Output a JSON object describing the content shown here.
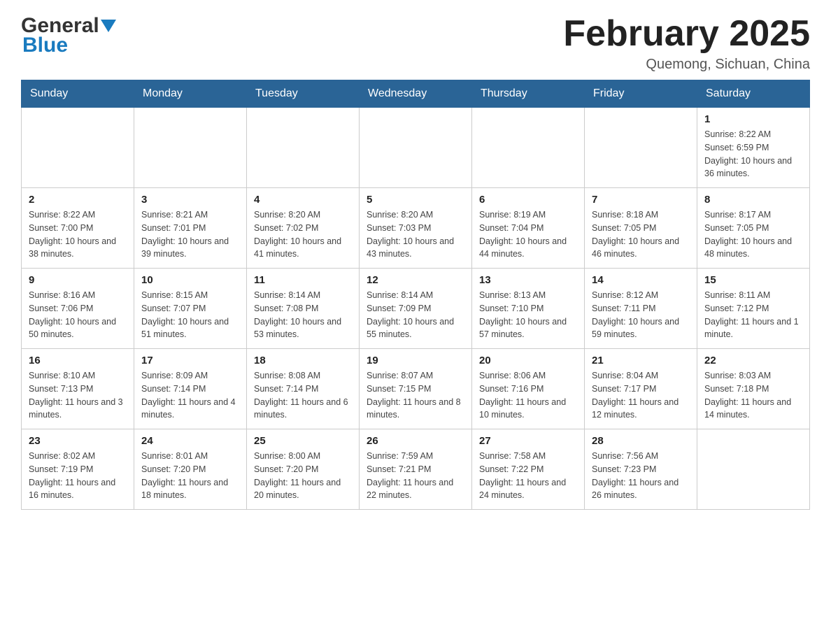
{
  "header": {
    "logo_general": "General",
    "logo_blue": "Blue",
    "month_title": "February 2025",
    "location": "Quemong, Sichuan, China"
  },
  "days_of_week": [
    "Sunday",
    "Monday",
    "Tuesday",
    "Wednesday",
    "Thursday",
    "Friday",
    "Saturday"
  ],
  "weeks": [
    [
      {
        "day": "",
        "sunrise": "",
        "sunset": "",
        "daylight": ""
      },
      {
        "day": "",
        "sunrise": "",
        "sunset": "",
        "daylight": ""
      },
      {
        "day": "",
        "sunrise": "",
        "sunset": "",
        "daylight": ""
      },
      {
        "day": "",
        "sunrise": "",
        "sunset": "",
        "daylight": ""
      },
      {
        "day": "",
        "sunrise": "",
        "sunset": "",
        "daylight": ""
      },
      {
        "day": "",
        "sunrise": "",
        "sunset": "",
        "daylight": ""
      },
      {
        "day": "1",
        "sunrise": "Sunrise: 8:22 AM",
        "sunset": "Sunset: 6:59 PM",
        "daylight": "Daylight: 10 hours and 36 minutes."
      }
    ],
    [
      {
        "day": "2",
        "sunrise": "Sunrise: 8:22 AM",
        "sunset": "Sunset: 7:00 PM",
        "daylight": "Daylight: 10 hours and 38 minutes."
      },
      {
        "day": "3",
        "sunrise": "Sunrise: 8:21 AM",
        "sunset": "Sunset: 7:01 PM",
        "daylight": "Daylight: 10 hours and 39 minutes."
      },
      {
        "day": "4",
        "sunrise": "Sunrise: 8:20 AM",
        "sunset": "Sunset: 7:02 PM",
        "daylight": "Daylight: 10 hours and 41 minutes."
      },
      {
        "day": "5",
        "sunrise": "Sunrise: 8:20 AM",
        "sunset": "Sunset: 7:03 PM",
        "daylight": "Daylight: 10 hours and 43 minutes."
      },
      {
        "day": "6",
        "sunrise": "Sunrise: 8:19 AM",
        "sunset": "Sunset: 7:04 PM",
        "daylight": "Daylight: 10 hours and 44 minutes."
      },
      {
        "day": "7",
        "sunrise": "Sunrise: 8:18 AM",
        "sunset": "Sunset: 7:05 PM",
        "daylight": "Daylight: 10 hours and 46 minutes."
      },
      {
        "day": "8",
        "sunrise": "Sunrise: 8:17 AM",
        "sunset": "Sunset: 7:05 PM",
        "daylight": "Daylight: 10 hours and 48 minutes."
      }
    ],
    [
      {
        "day": "9",
        "sunrise": "Sunrise: 8:16 AM",
        "sunset": "Sunset: 7:06 PM",
        "daylight": "Daylight: 10 hours and 50 minutes."
      },
      {
        "day": "10",
        "sunrise": "Sunrise: 8:15 AM",
        "sunset": "Sunset: 7:07 PM",
        "daylight": "Daylight: 10 hours and 51 minutes."
      },
      {
        "day": "11",
        "sunrise": "Sunrise: 8:14 AM",
        "sunset": "Sunset: 7:08 PM",
        "daylight": "Daylight: 10 hours and 53 minutes."
      },
      {
        "day": "12",
        "sunrise": "Sunrise: 8:14 AM",
        "sunset": "Sunset: 7:09 PM",
        "daylight": "Daylight: 10 hours and 55 minutes."
      },
      {
        "day": "13",
        "sunrise": "Sunrise: 8:13 AM",
        "sunset": "Sunset: 7:10 PM",
        "daylight": "Daylight: 10 hours and 57 minutes."
      },
      {
        "day": "14",
        "sunrise": "Sunrise: 8:12 AM",
        "sunset": "Sunset: 7:11 PM",
        "daylight": "Daylight: 10 hours and 59 minutes."
      },
      {
        "day": "15",
        "sunrise": "Sunrise: 8:11 AM",
        "sunset": "Sunset: 7:12 PM",
        "daylight": "Daylight: 11 hours and 1 minute."
      }
    ],
    [
      {
        "day": "16",
        "sunrise": "Sunrise: 8:10 AM",
        "sunset": "Sunset: 7:13 PM",
        "daylight": "Daylight: 11 hours and 3 minutes."
      },
      {
        "day": "17",
        "sunrise": "Sunrise: 8:09 AM",
        "sunset": "Sunset: 7:14 PM",
        "daylight": "Daylight: 11 hours and 4 minutes."
      },
      {
        "day": "18",
        "sunrise": "Sunrise: 8:08 AM",
        "sunset": "Sunset: 7:14 PM",
        "daylight": "Daylight: 11 hours and 6 minutes."
      },
      {
        "day": "19",
        "sunrise": "Sunrise: 8:07 AM",
        "sunset": "Sunset: 7:15 PM",
        "daylight": "Daylight: 11 hours and 8 minutes."
      },
      {
        "day": "20",
        "sunrise": "Sunrise: 8:06 AM",
        "sunset": "Sunset: 7:16 PM",
        "daylight": "Daylight: 11 hours and 10 minutes."
      },
      {
        "day": "21",
        "sunrise": "Sunrise: 8:04 AM",
        "sunset": "Sunset: 7:17 PM",
        "daylight": "Daylight: 11 hours and 12 minutes."
      },
      {
        "day": "22",
        "sunrise": "Sunrise: 8:03 AM",
        "sunset": "Sunset: 7:18 PM",
        "daylight": "Daylight: 11 hours and 14 minutes."
      }
    ],
    [
      {
        "day": "23",
        "sunrise": "Sunrise: 8:02 AM",
        "sunset": "Sunset: 7:19 PM",
        "daylight": "Daylight: 11 hours and 16 minutes."
      },
      {
        "day": "24",
        "sunrise": "Sunrise: 8:01 AM",
        "sunset": "Sunset: 7:20 PM",
        "daylight": "Daylight: 11 hours and 18 minutes."
      },
      {
        "day": "25",
        "sunrise": "Sunrise: 8:00 AM",
        "sunset": "Sunset: 7:20 PM",
        "daylight": "Daylight: 11 hours and 20 minutes."
      },
      {
        "day": "26",
        "sunrise": "Sunrise: 7:59 AM",
        "sunset": "Sunset: 7:21 PM",
        "daylight": "Daylight: 11 hours and 22 minutes."
      },
      {
        "day": "27",
        "sunrise": "Sunrise: 7:58 AM",
        "sunset": "Sunset: 7:22 PM",
        "daylight": "Daylight: 11 hours and 24 minutes."
      },
      {
        "day": "28",
        "sunrise": "Sunrise: 7:56 AM",
        "sunset": "Sunset: 7:23 PM",
        "daylight": "Daylight: 11 hours and 26 minutes."
      },
      {
        "day": "",
        "sunrise": "",
        "sunset": "",
        "daylight": ""
      }
    ]
  ]
}
